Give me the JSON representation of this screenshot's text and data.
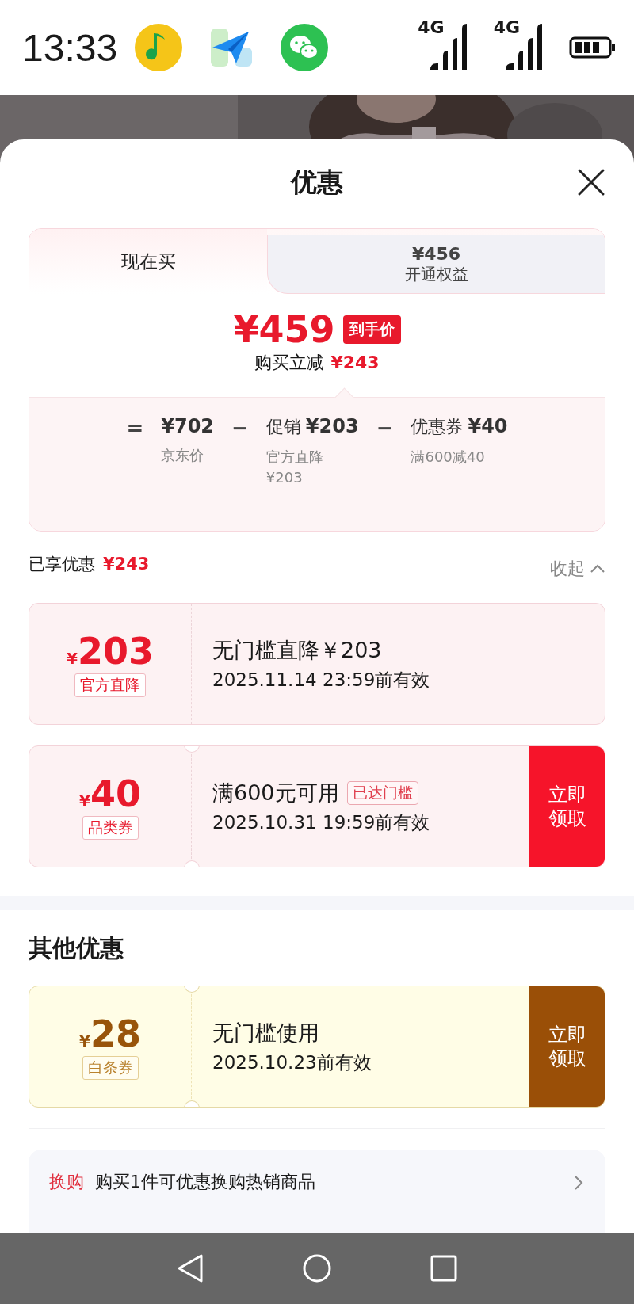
{
  "status_bar": {
    "time": "13:33",
    "networks": [
      {
        "label": "4G"
      },
      {
        "label": "4G"
      }
    ]
  },
  "sheet": {
    "title": "优惠"
  },
  "price_card": {
    "tabs": [
      {
        "label": "现在买",
        "selected": true
      },
      {
        "price": "¥456",
        "label": "开通权益",
        "selected": false
      }
    ],
    "final_price": "¥459",
    "price_badge": "到手价",
    "saving_label": "购买立减",
    "saving": "¥243",
    "breakdown": [
      {
        "operator": "=",
        "amount": "¥702",
        "note": "京东价"
      },
      {
        "operator": "−",
        "label": "促销",
        "amount": "¥203",
        "note": "官方直降\n¥203"
      },
      {
        "operator": "−",
        "label": "优惠券",
        "amount": "¥40",
        "note": "满600减40"
      }
    ]
  },
  "enjoyed": {
    "label": "已享优惠",
    "amount": "¥243",
    "toggle": "收起",
    "expanded": true
  },
  "coupons": [
    {
      "kind": "red",
      "currency": "¥",
      "amount": "203",
      "tag": "官方直降",
      "title": "无门槛直降￥203",
      "validity": "2025.11.14 23:59前有效",
      "notched": false
    },
    {
      "kind": "red",
      "currency": "¥",
      "amount": "40",
      "tag": "品类券",
      "title": "满600元可用",
      "badge": "已达门槛",
      "validity": "2025.10.31 19:59前有效",
      "action": "立即领取",
      "notched": true
    }
  ],
  "other": {
    "title": "其他优惠",
    "coupons": [
      {
        "kind": "gold",
        "currency": "¥",
        "amount": "28",
        "tag": "白条券",
        "title": "无门槛使用",
        "validity": "2025.10.23前有效",
        "action": "立即领取",
        "notched": true
      }
    ]
  },
  "exchange": {
    "tag": "换购",
    "text": "购买1件可优惠换购热销商品"
  }
}
